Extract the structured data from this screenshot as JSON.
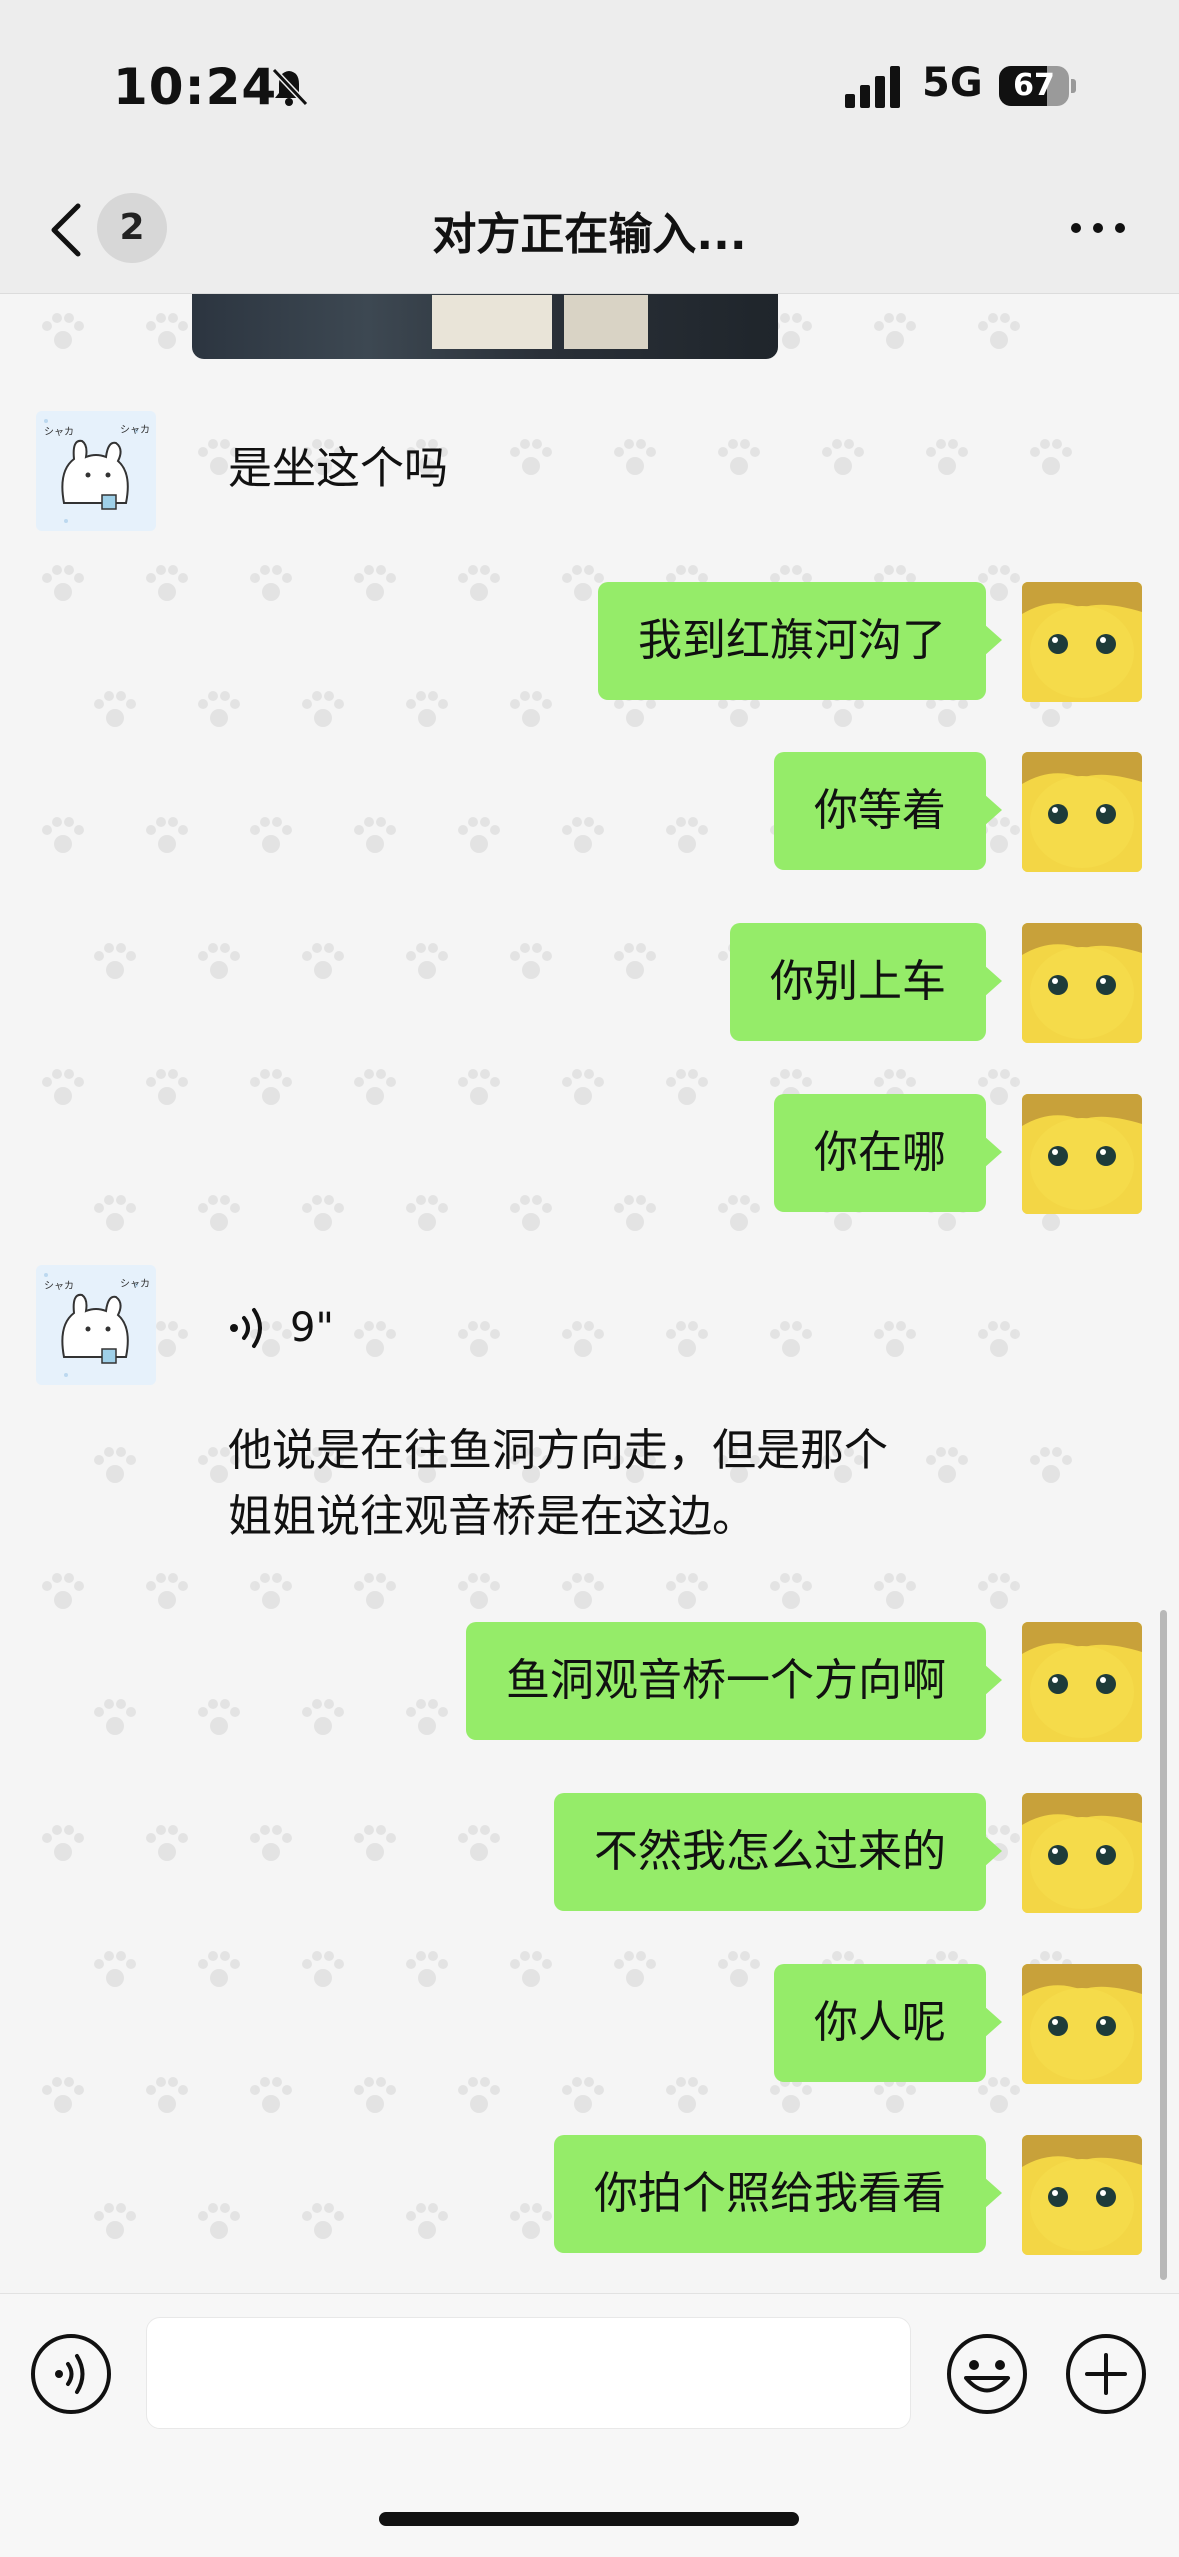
{
  "status_bar": {
    "time": "10:24",
    "network": "5G",
    "battery": "67"
  },
  "nav": {
    "unread_count": "2",
    "title": "对方正在输入..."
  },
  "messages": [
    {
      "side": "in",
      "type": "text",
      "text": "是坐这个吗"
    },
    {
      "side": "out",
      "type": "text",
      "text": "我到红旗河沟了"
    },
    {
      "side": "out",
      "type": "text",
      "text": "你等着"
    },
    {
      "side": "out",
      "type": "text",
      "text": "你别上车"
    },
    {
      "side": "out",
      "type": "text",
      "text": "你在哪"
    },
    {
      "side": "in",
      "type": "voice",
      "duration": "9\""
    },
    {
      "side": "in",
      "type": "text",
      "text": "他说是在往鱼洞方向走，但是那个\n姐姐说往观音桥是在这边。"
    },
    {
      "side": "out",
      "type": "text",
      "text": "鱼洞观音桥一个方向啊"
    },
    {
      "side": "out",
      "type": "text",
      "text": "不然我怎么过来的"
    },
    {
      "side": "out",
      "type": "text",
      "text": "你人呢"
    },
    {
      "side": "out",
      "type": "text",
      "text": "你拍个照给我看看"
    }
  ],
  "input": {
    "value": "",
    "placeholder": ""
  },
  "colors": {
    "outgoing_bubble": "#95ec69",
    "background": "#f5f5f5",
    "header": "#ededed"
  },
  "icons": [
    "bell-mute-icon",
    "signal-icon",
    "battery-icon",
    "back-arrow-icon",
    "more-icon",
    "voice-wave-icon",
    "voice-input-icon",
    "emoji-icon",
    "plus-icon"
  ]
}
